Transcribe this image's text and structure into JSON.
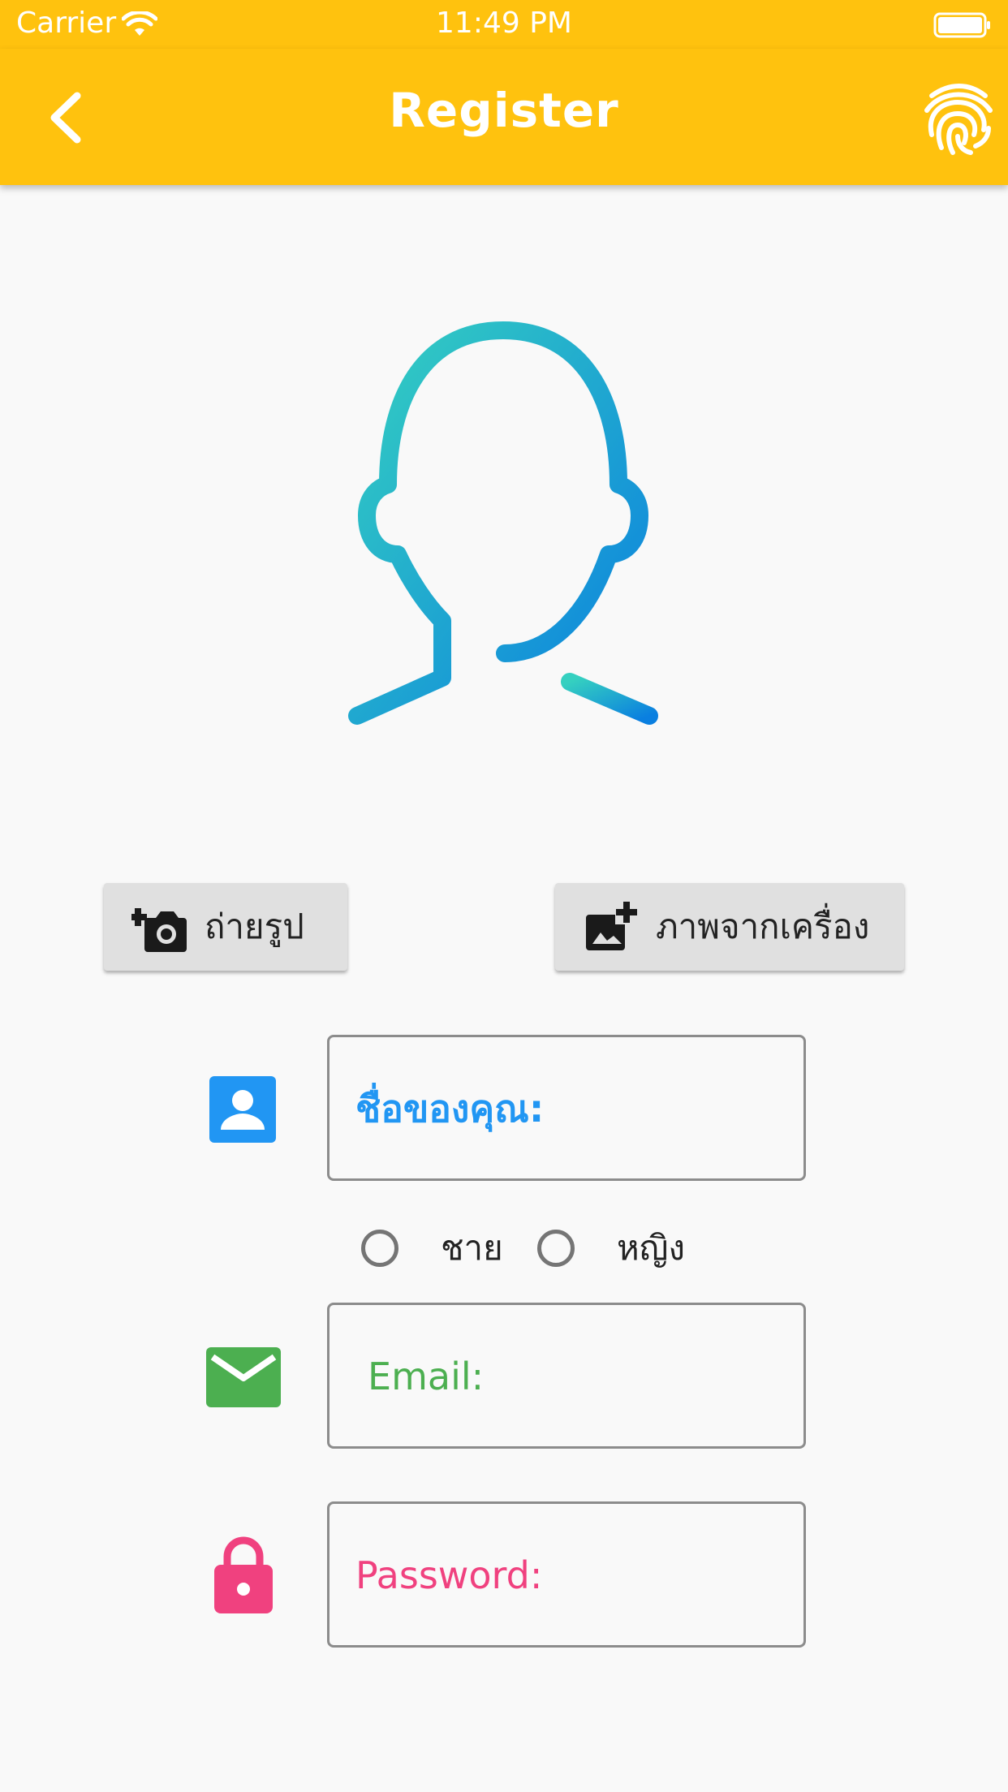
{
  "status_bar": {
    "carrier": "Carrier",
    "time": "11:49 PM"
  },
  "app_bar": {
    "title": "Register",
    "color": "#FFC20E"
  },
  "photo_buttons": {
    "camera_label": "ถ่ายรูป",
    "gallery_label": "ภาพจากเครื่อง"
  },
  "form": {
    "name_placeholder": "ชื่อของคุณ:",
    "email_placeholder": "Email:",
    "password_placeholder": "Password:",
    "gender_options": [
      "ชาย",
      "หญิง"
    ]
  },
  "colors": {
    "name_accent": "#2196F3",
    "email_accent": "#4CAF50",
    "password_accent": "#F0417F"
  },
  "icons": {
    "back": "chevron-left-icon",
    "fingerprint": "fingerprint-icon",
    "camera": "add-a-photo-icon",
    "gallery": "add-photo-alternate-icon",
    "name": "person-icon",
    "email": "mail-icon",
    "password": "lock-icon"
  }
}
